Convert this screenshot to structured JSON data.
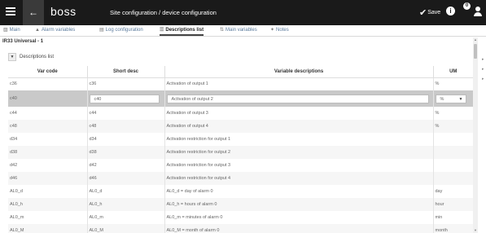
{
  "header": {
    "logo": "boss",
    "title": "Site configuration / device configuration",
    "save_label": "Save",
    "notification_count": "0"
  },
  "tabs": [
    {
      "label": "Main",
      "icon": "monitor-icon"
    },
    {
      "label": "Alarm variables",
      "icon": "alarm-icon"
    },
    {
      "label": "Log configuration",
      "icon": "log-icon"
    },
    {
      "label": "Descriptions list",
      "icon": "list-icon",
      "active": true
    },
    {
      "label": "Main variables",
      "icon": "arrows-icon"
    },
    {
      "label": "Notes",
      "icon": "notes-icon"
    }
  ],
  "section": {
    "title": "IR33 Universal - 1",
    "collapse_label": "Descriptions list"
  },
  "table": {
    "columns": [
      "Var code",
      "Short desc",
      "Variable descriptions",
      "UM"
    ],
    "rows": [
      {
        "code": "c36",
        "short": "c36",
        "desc": "Activation of output 1",
        "um": "%"
      },
      {
        "code": "c40",
        "short": "c40",
        "desc": "Activation of output 2",
        "um": "%",
        "selected": true
      },
      {
        "code": "c44",
        "short": "c44",
        "desc": "Activation of output 3",
        "um": "%"
      },
      {
        "code": "c48",
        "short": "c48",
        "desc": "Activation of output 4",
        "um": "%"
      },
      {
        "code": "d34",
        "short": "d34",
        "desc": "Activation restriction for output 1",
        "um": ""
      },
      {
        "code": "d38",
        "short": "d38",
        "desc": "Activation restriction for output 2",
        "um": ""
      },
      {
        "code": "d42",
        "short": "d42",
        "desc": "Activation restriction for output 3",
        "um": ""
      },
      {
        "code": "d46",
        "short": "d46",
        "desc": "Activation restriction for output 4",
        "um": ""
      },
      {
        "code": "AL0_d",
        "short": "AL0_d",
        "desc": "AL0_d = day of alarm 0",
        "um": "day"
      },
      {
        "code": "AL0_h",
        "short": "AL0_h",
        "desc": "AL0_h = hours of alarm 0",
        "um": "hour"
      },
      {
        "code": "AL0_m",
        "short": "AL0_m",
        "desc": "AL0_m = minutes of alarm 0",
        "um": "min"
      },
      {
        "code": "AL0_M",
        "short": "AL0_M",
        "desc": "AL0_M = month of alarm 0",
        "um": "month"
      }
    ]
  },
  "colors": {
    "topbar": "#1a1a1a",
    "tab_link": "#5a7a9c",
    "selected_row": "#c9c9c9",
    "alt_row": "#f6f6f6"
  }
}
